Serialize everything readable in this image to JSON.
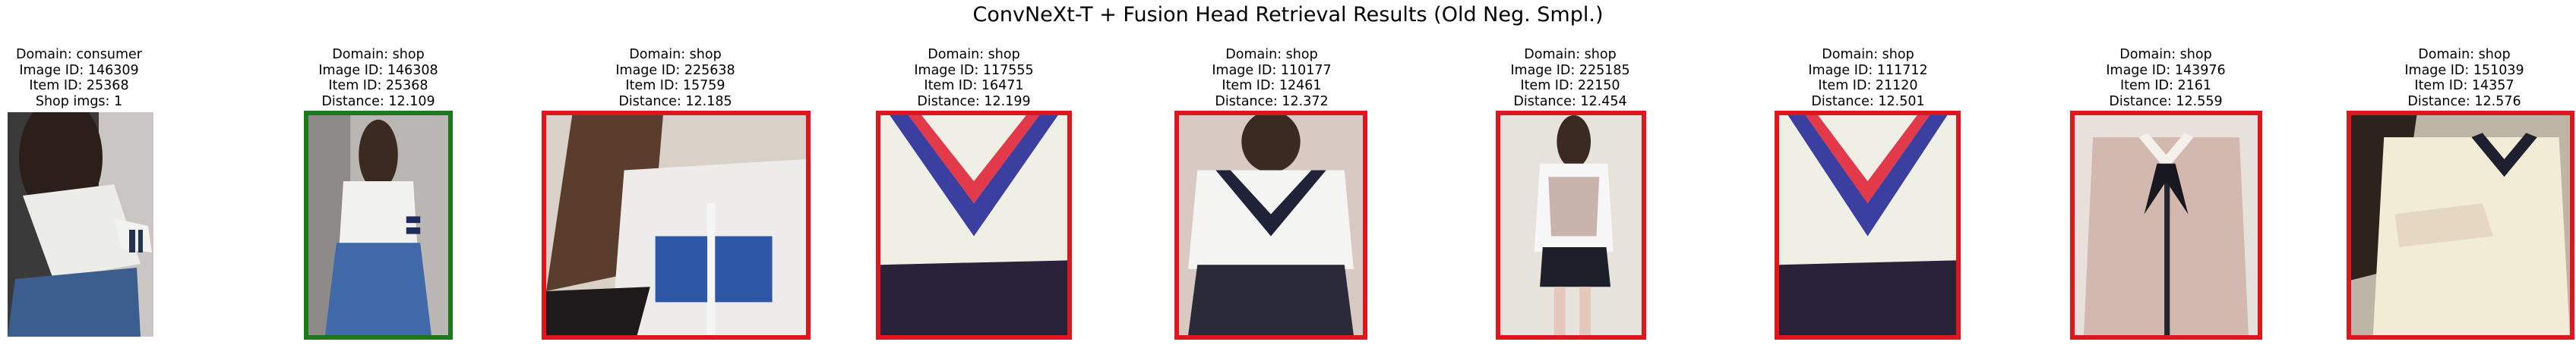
{
  "title": "ConvNeXt-T + Fusion Head Retrieval Results (Old Neg. Smpl.)",
  "query": {
    "domain": "Domain: consumer",
    "image_id": "Image ID: 146309",
    "item_id": "Item ID: 25368",
    "shop_imgs": "Shop imgs: 1"
  },
  "results": [
    {
      "domain": "Domain: shop",
      "image_id": "Image ID: 146308",
      "item_id": "Item ID: 25368",
      "distance": "Distance: 12.109",
      "match": true
    },
    {
      "domain": "Domain: shop",
      "image_id": "Image ID: 225638",
      "item_id": "Item ID: 15759",
      "distance": "Distance: 12.185",
      "match": false
    },
    {
      "domain": "Domain: shop",
      "image_id": "Image ID: 117555",
      "item_id": "Item ID: 16471",
      "distance": "Distance: 12.199",
      "match": false
    },
    {
      "domain": "Domain: shop",
      "image_id": "Image ID: 110177",
      "item_id": "Item ID: 12461",
      "distance": "Distance: 12.372",
      "match": false
    },
    {
      "domain": "Domain: shop",
      "image_id": "Image ID: 225185",
      "item_id": "Item ID: 22150",
      "distance": "Distance: 12.454",
      "match": false
    },
    {
      "domain": "Domain: shop",
      "image_id": "Image ID: 111712",
      "item_id": "Item ID: 21120",
      "distance": "Distance: 12.501",
      "match": false
    },
    {
      "domain": "Domain: shop",
      "image_id": "Image ID: 143976",
      "item_id": "Item ID: 2161",
      "distance": "Distance: 12.559",
      "match": false
    },
    {
      "domain": "Domain: shop",
      "image_id": "Image ID: 151039",
      "item_id": "Item ID: 14357",
      "distance": "Distance: 12.576",
      "match": false
    }
  ],
  "colors": {
    "match_border": "#1a7a1a",
    "nonmatch_border": "#e0161c"
  }
}
